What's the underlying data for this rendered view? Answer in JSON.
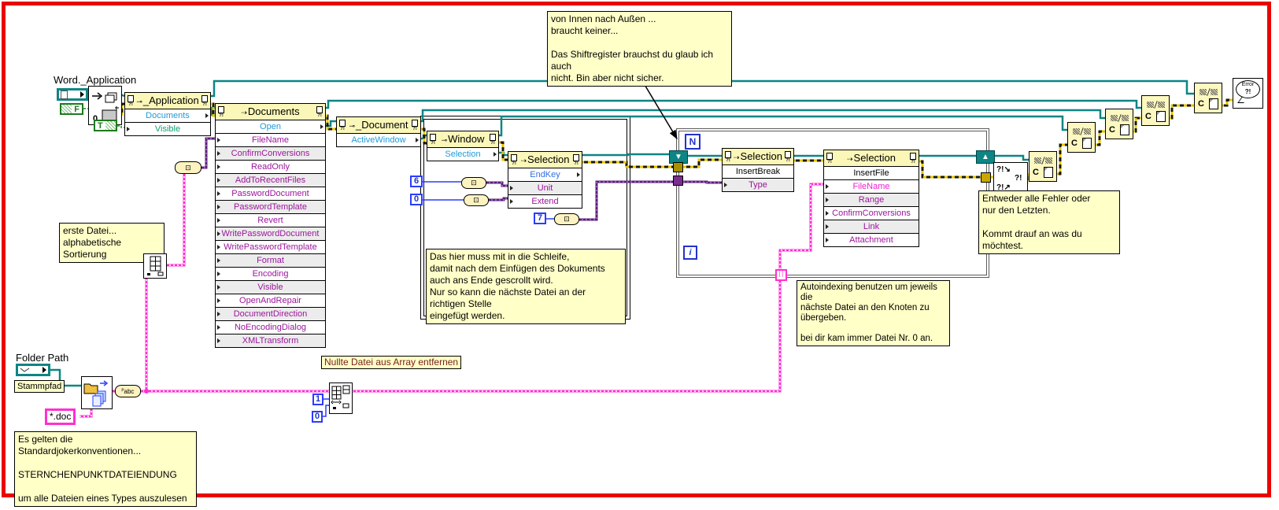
{
  "labels": {
    "word_application": "Word._Application",
    "folder_path": "Folder Path",
    "stammpfad": "Stammpfad",
    "wildcard": "*.doc",
    "nullte": "Nullte Datei aus Array entfernen"
  },
  "comments": {
    "top": "von Innen nach Außen ...\nbraucht keiner...\n\nDas Shiftregister brauchst du glaub ich auch\nnicht. Bin aber nicht sicher.",
    "erste": "erste Datei...\nalphabetische Sortierung",
    "schleife": "Das hier muss mit in die Schleife,\ndamit nach dem Einfügen des Dokuments\nauch ans Ende gescrollt wird.\nNur so kann die nächste Datei an der richtigen Stelle\neingefügt werden.",
    "autoindexing": "Autoindexing benutzen um jeweils die\nnächste Datei an den Knoten zu übergeben.\n\nbei dir kam immer Datei Nr. 0 an.",
    "fehler": "Entweder alle Fehler oder\nnur den Letzten.\n\nKommt drauf an was du möchtest.",
    "joker": "Es gelten die Standardjokerkonventionen...\n\nSTERNCHENPUNKTDATEIENDUNG\n\num alle Dateien eines Types auszulesen"
  },
  "nodes": {
    "application": {
      "title": "_Application",
      "rows": [
        "Documents",
        "Visible"
      ]
    },
    "documents": {
      "title": "Documents",
      "method": "Open",
      "params": [
        "FileName",
        "ConfirmConversions",
        "ReadOnly",
        "AddToRecentFiles",
        "PasswordDocument",
        "PasswordTemplate",
        "Revert",
        "WritePasswordDocument",
        "WritePasswordTemplate",
        "Format",
        "Encoding",
        "Visible",
        "OpenAndRepair",
        "DocumentDirection",
        "NoEncodingDialog",
        "XMLTransform"
      ]
    },
    "document": {
      "title": "_Document",
      "rows": [
        "ActiveWindow"
      ]
    },
    "window": {
      "title": "Window",
      "rows": [
        "Selection"
      ]
    },
    "endkey": {
      "title": "Selection",
      "method": "EndKey",
      "params": [
        "Unit",
        "Extend"
      ]
    },
    "insertbreak": {
      "title": "Selection",
      "method": "InsertBreak",
      "params": [
        "Type"
      ]
    },
    "insertfile": {
      "title": "Selection",
      "method": "InsertFile",
      "params": [
        "FileName",
        "Range",
        "ConfirmConversions",
        "Link",
        "Attachment"
      ]
    }
  },
  "constants": {
    "bool_false": "F",
    "bool_true": "T",
    "six": "6",
    "zero_a": "0",
    "seven": "7",
    "one": "1",
    "zero_b": "0"
  },
  "loop": {
    "count": "N",
    "iteration": "i"
  },
  "misc": {
    "node_glyph": "?!",
    "close_label": "C",
    "merge_tl": "?!↘",
    "merge_mid": "?!",
    "merge_bl": "?!↗",
    "error_line1": "Error",
    "error_line2": "?!",
    "abc": "abc"
  },
  "colors": {
    "annotation_red": "#ec0000",
    "comment_bg": "#ffffc8",
    "node_header": "#fbf7b8",
    "refnum_teal": "#0d8584",
    "error_yellow": "#e8c400",
    "string_pink": "#ff2fd0",
    "variant_purple": "#5a1d7a",
    "boolean_green": "#1e8a1e",
    "numeric_blue": "#2a3cff"
  }
}
